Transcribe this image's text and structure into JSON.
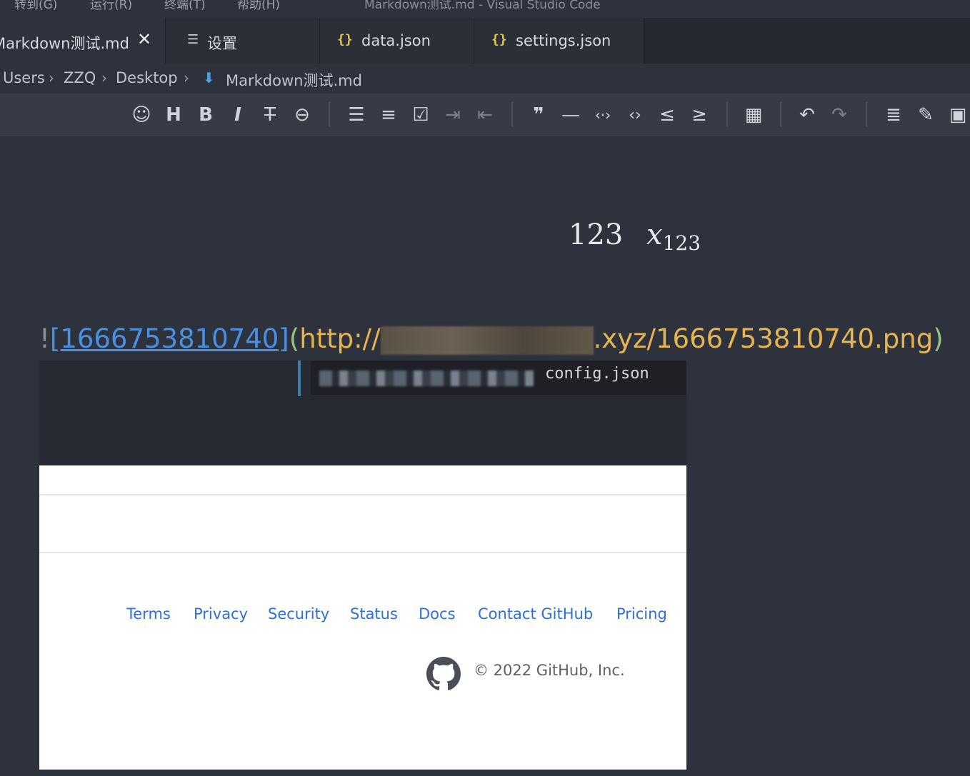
{
  "window": {
    "menu": [
      "转到(G)",
      "运行(R)",
      "终端(T)",
      "帮助(H)"
    ],
    "title": "Markdown测试.md - Visual Studio Code"
  },
  "tabs": [
    {
      "label": "Markdown测试.md",
      "icon": "markdown-file-icon",
      "active": true
    },
    {
      "label": "设置",
      "icon": "settings-icon"
    },
    {
      "label": "data.json",
      "icon": "json-icon"
    },
    {
      "label": "settings.json",
      "icon": "json-icon"
    }
  ],
  "breadcrumb": [
    "Users",
    "ZZQ",
    "Desktop",
    "Markdown测试.md"
  ],
  "toolbar": {
    "buttons": [
      "emoji-icon",
      "heading-icon",
      "bold-icon",
      "italic-icon",
      "strikethrough-icon",
      "link-icon",
      "bullet-list-icon",
      "ordered-list-icon",
      "task-list-icon",
      "indent-icon",
      "outdent-icon",
      "quote-icon",
      "horizontal-rule-icon",
      "inline-code-icon",
      "code-block-icon",
      "insert-before-icon",
      "insert-after-icon",
      "table-icon",
      "undo-icon",
      "redo-icon",
      "align-center-icon",
      "edit-icon",
      "save-icon"
    ]
  },
  "editor": {
    "math_number": "123",
    "math_var": "x",
    "math_sub": "123",
    "image_link": {
      "bang": "!",
      "alt": "[1666753810740]",
      "open_paren": "(",
      "url_prefix": "http://",
      "url_suffix": ".xyz/1666753810740.png",
      "close_paren": ")"
    },
    "embedded_image": {
      "config_text": "config.json",
      "footer_links": [
        "Terms",
        "Privacy",
        "Security",
        "Status",
        "Docs",
        "Contact GitHub",
        "Pricing"
      ],
      "copyright": "© 2022 GitHub, Inc."
    }
  }
}
